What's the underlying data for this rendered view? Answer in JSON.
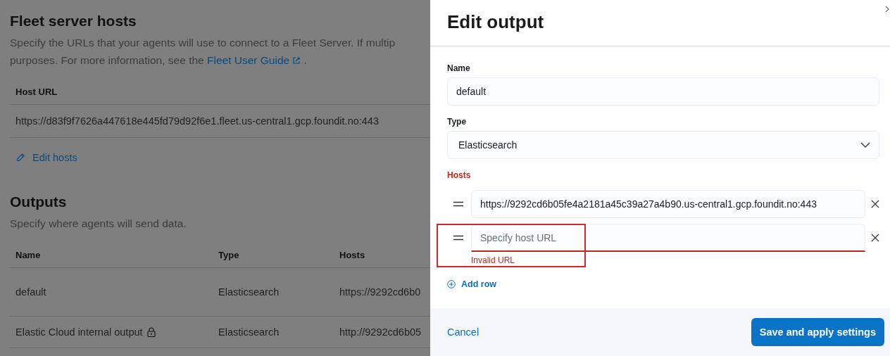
{
  "fleet_hosts": {
    "title": "Fleet server hosts",
    "description": "Specify the URLs that your agents will use to connect to a Fleet Server. If multip",
    "description_2": "purposes. For more information, see the",
    "link": "Fleet User Guide",
    "description_end": ".",
    "columns": [
      "Host URL"
    ],
    "rows": [
      "https://d83f9f7626a447618e445fd79d92f6e1.fleet.us-central1.gcp.foundit.no:443"
    ],
    "edit_link": "Edit hosts"
  },
  "outputs": {
    "title": "Outputs",
    "description": "Specify where agents will send data.",
    "columns": [
      "Name",
      "Type",
      "Hosts"
    ],
    "rows": [
      {
        "name": "default",
        "type": "Elasticsearch",
        "hosts": "https://9292cd6b0",
        "locked": false
      },
      {
        "name": "Elastic Cloud internal output",
        "type": "Elasticsearch",
        "hosts": "http://9292cd6b05",
        "locked": true
      }
    ]
  },
  "flyout": {
    "title": "Edit output",
    "name": {
      "label": "Name",
      "value": "default"
    },
    "type": {
      "label": "Type",
      "value": "Elasticsearch"
    },
    "hosts": {
      "label": "Hosts",
      "invalid": true,
      "rows": [
        {
          "value": "https://9292cd6b05fe4a2181a45c39a27a4b90.us-central1.gcp.foundit.no:443",
          "invalid": false,
          "highlighted": false
        },
        {
          "placeholder": "Specify host URL",
          "invalid": true,
          "error": "Invalid URL",
          "highlighted": true
        }
      ],
      "add_row": "Add row"
    },
    "cancel": "Cancel",
    "submit": "Save and apply settings"
  }
}
